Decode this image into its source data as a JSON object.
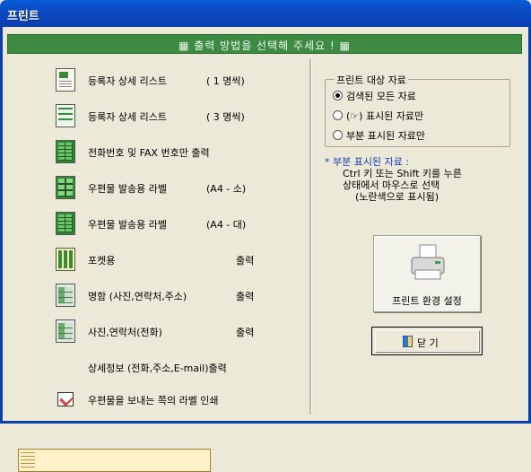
{
  "window": {
    "title": "프린트"
  },
  "banner": {
    "text": "▦  출력 방법을 선택해 주세요 !  ▦"
  },
  "options": [
    {
      "label": "등록자 상세 리스트",
      "right": "( 1 명씩)",
      "icon": "single-card-icon"
    },
    {
      "label": "등록자 상세 리스트",
      "right": "( 3 명씩)",
      "icon": "triple-list-icon"
    },
    {
      "label": "전화번호 및 FAX 번호만 출력",
      "right": "",
      "icon": "phone-grid-icon"
    },
    {
      "label": "우편물 발송용 라벨",
      "right": "(A4 - 소)",
      "icon": "label-small-icon"
    },
    {
      "label": "우편물 발송용 라벨",
      "right": "(A4 - 대)",
      "icon": "label-large-icon"
    },
    {
      "label": "포켓용",
      "right": "출력",
      "icon": "pocket-icon"
    },
    {
      "label": "명함 (사진,연락처,주소)",
      "right": "출력",
      "icon": "business-card-icon"
    },
    {
      "label": "사진,연락처(전화)",
      "right": "출력",
      "icon": "photo-contact-icon"
    },
    {
      "label": "상세정보 (전화,주소,E-mail)출력",
      "right": "",
      "icon": "detail-info-icon"
    },
    {
      "label": "우편물을 보내는 쪽의 라벨 인쇄",
      "right": "",
      "icon": "envelope-icon"
    }
  ],
  "target": {
    "legend": "프린트 대상 자료",
    "radios": [
      {
        "label": "검색된 모든 자료",
        "selected": true
      },
      {
        "label": "(☞) 표시된 자료만",
        "selected": false
      },
      {
        "label": "부분 표시된 자료만",
        "selected": false
      }
    ]
  },
  "note": {
    "heading": "* 부분 표시된 자료 :",
    "line1": "Ctrl 키 또는 Shift 키를 누른",
    "line2": "상태에서 마우스로 선택",
    "line3": "(노란색으로 표시됨)"
  },
  "buttons": {
    "print_setup": "프린트 환경 설정",
    "close": "닫 기"
  }
}
